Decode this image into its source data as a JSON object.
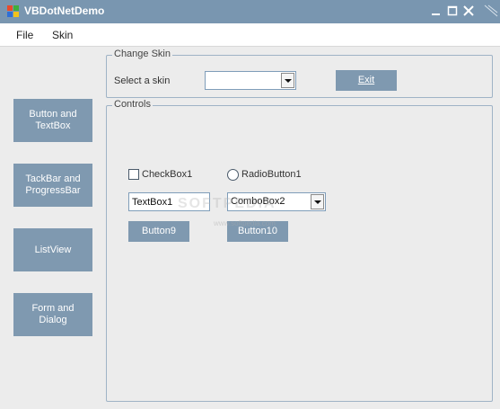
{
  "window": {
    "title": "VBDotNetDemo"
  },
  "menu": {
    "file_label": "File",
    "skin_label": "Skin"
  },
  "sidebar": {
    "buttons": [
      {
        "label": "Button and TextBox"
      },
      {
        "label": "TackBar and ProgressBar"
      },
      {
        "label": "ListView"
      },
      {
        "label": "Form and Dialog"
      }
    ]
  },
  "change_skin": {
    "legend": "Change Skin",
    "select_label": "Select a skin",
    "select_value": "",
    "exit_label": "Exit"
  },
  "controls": {
    "legend": "Controls",
    "checkbox_label": "CheckBox1",
    "radio_label": "RadioButton1",
    "textbox_value": "TextBox1",
    "combo_value": "ComboBox2",
    "button9_label": "Button9",
    "button10_label": "Button10"
  },
  "watermark": {
    "main": "SOFTPEDIA",
    "sub": "www.softpedia.com"
  },
  "colors": {
    "title_bar": "#7996b0",
    "flat_button": "#7f99b0",
    "group_border": "#9fb3c6"
  }
}
